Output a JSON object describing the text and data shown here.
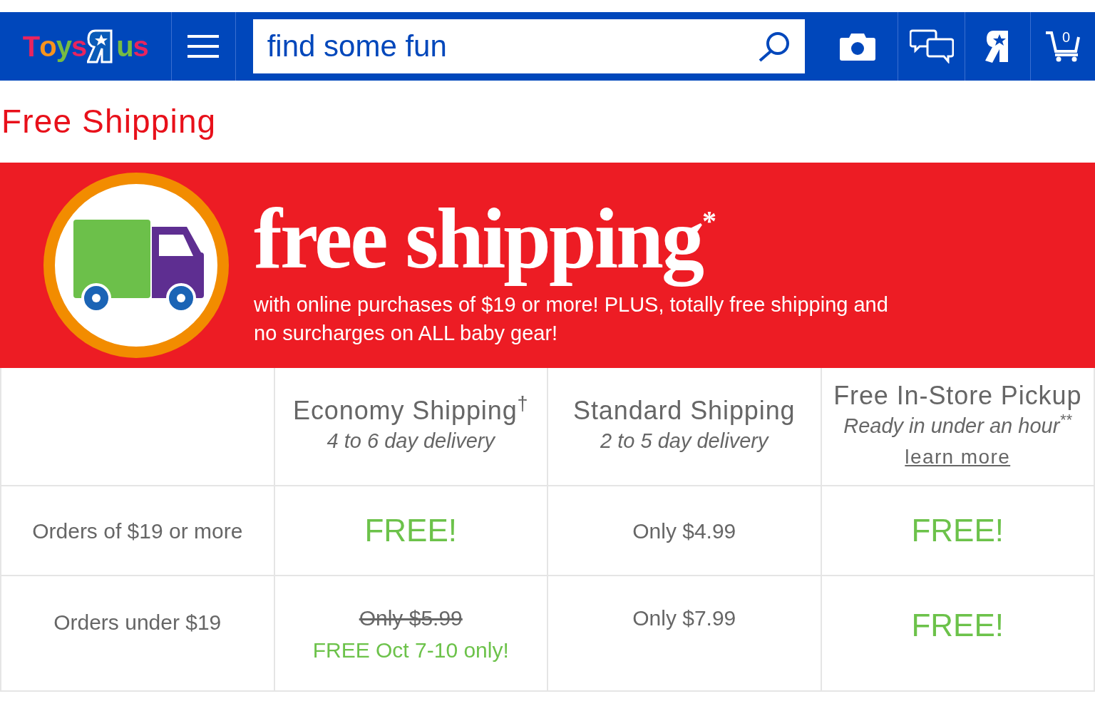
{
  "header": {
    "logo": {
      "left": "Toys",
      "right": "us"
    },
    "search": {
      "placeholder": "find some fun"
    },
    "cart_count": "0"
  },
  "page_title": "Free Shipping",
  "banner": {
    "headline": "free shipping$^{*}$",
    "subtext": "with online purchases of $19 or more! PLUS, totally free shipping and no surcharges on ALL baby gear!"
  },
  "table": {
    "columns": [
      {
        "title": "Economy Shipping$^{†}$",
        "subtitle": "4 to 6 day delivery"
      },
      {
        "title": "Standard Shipping",
        "subtitle": "2 to 5 day delivery"
      },
      {
        "title": "Free In-Store Pickup",
        "subtitle": "Ready in under an hour$^{**}$",
        "link": "learn more"
      }
    ],
    "rows": [
      {
        "label": "Orders of $19 or more",
        "cells": [
          {
            "kind": "free",
            "text": "FREE!"
          },
          {
            "kind": "price",
            "text": "Only $4.99"
          },
          {
            "kind": "free",
            "text": "FREE!"
          }
        ]
      },
      {
        "label": "Orders under $19",
        "cells": [
          {
            "kind": "struck",
            "text": "Only $5.99",
            "note": "FREE Oct 7-10 only!"
          },
          {
            "kind": "price",
            "text": "Only $7.99"
          },
          {
            "kind": "free",
            "text": "FREE!"
          }
        ]
      }
    ]
  }
}
